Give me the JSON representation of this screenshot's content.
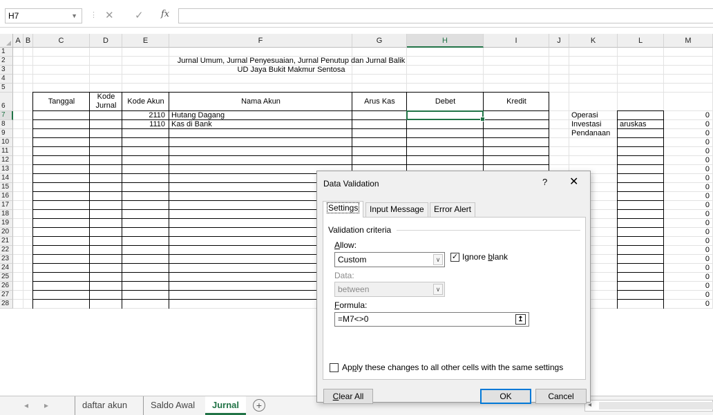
{
  "formula_bar": {
    "name_box": "H7",
    "cancel_icon": "✕",
    "enter_icon": "✓",
    "fx": "fx",
    "formula": ""
  },
  "columns": [
    "A",
    "B",
    "C",
    "D",
    "E",
    "F",
    "G",
    "H",
    "I",
    "J",
    "K",
    "L",
    "M"
  ],
  "rows": [
    "1",
    "2",
    "3",
    "4",
    "5",
    "6",
    "7",
    "8",
    "9",
    "10",
    "11",
    "12",
    "13",
    "14",
    "15",
    "16",
    "17",
    "18",
    "19",
    "20",
    "21",
    "22",
    "23",
    "24",
    "25",
    "26",
    "27",
    "28"
  ],
  "sheet": {
    "title": "Jurnal Umum, Jurnal Penyesuaian, Jurnal Penutup dan Jurnal Balik",
    "subtitle": "UD Jaya Bukit Makmur Sentosa",
    "headers": {
      "tanggal": "Tanggal",
      "kode_jurnal_1": "Kode",
      "kode_jurnal_2": "Jurnal",
      "kode_akun": "Kode Akun",
      "nama_akun": "Nama Akun",
      "arus_kas": "Arus Kas",
      "debet": "Debet",
      "kredit": "Kredit"
    },
    "entries": [
      {
        "kode_akun": "2110",
        "nama_akun": "Hutang Dagang"
      },
      {
        "kode_akun": "1110",
        "nama_akun": "Kas di Bank"
      }
    ],
    "side_labels": [
      "Operasi",
      "Investasi",
      "Pendanaan"
    ],
    "side_value": "aruskas",
    "zero": "0"
  },
  "tabs": {
    "daftar_akun": "daftar akun",
    "saldo_awal": "Saldo Awal",
    "jurnal": "Jurnal",
    "add": "+"
  },
  "dialog": {
    "title": "Data Validation",
    "help": "?",
    "close": "✕",
    "tabs": {
      "settings": "Settings",
      "input_message": "Input Message",
      "error_alert": "Error Alert"
    },
    "group": "Validation criteria",
    "allow_label_u": "A",
    "allow_label_rest": "llow:",
    "allow_value": "Custom",
    "ignore_blank_pre": "Ignore ",
    "ignore_blank_u": "b",
    "ignore_blank_post": "lank",
    "ignore_blank_checked": "✓",
    "data_label": "Data:",
    "data_value": "between",
    "formula_label_u": "F",
    "formula_label_rest": "ormula:",
    "formula_value": "=M7<>0",
    "apply_pre": "Ap",
    "apply_u": "p",
    "apply_post": "ly these changes to all other cells with the same settings",
    "clear_all_u": "C",
    "clear_all_rest": "lear All",
    "ok": "OK",
    "cancel": "Cancel"
  }
}
